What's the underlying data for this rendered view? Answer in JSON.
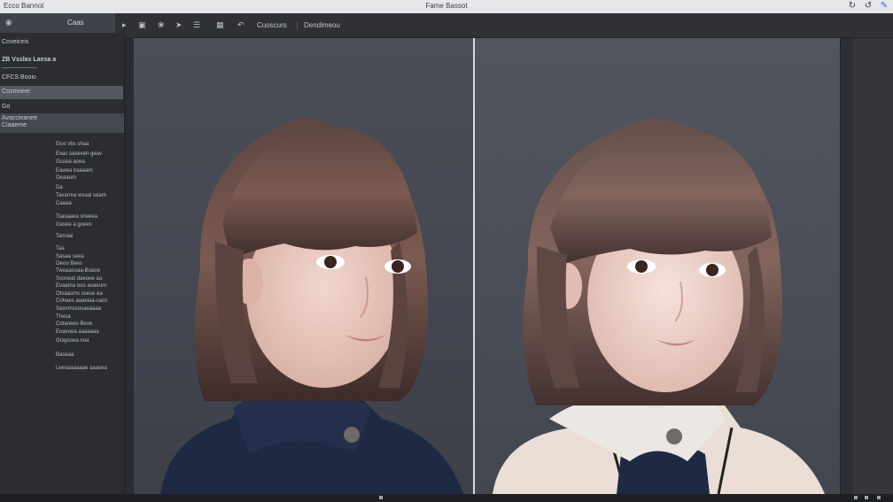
{
  "window": {
    "app_name": "Ecco Bannot",
    "title": "Fame Bassot"
  },
  "tab": {
    "label": "Caas"
  },
  "toolbar": {
    "breadcrumb_1": "Cuoscurs",
    "breadcrumb_2": "Dendimeou"
  },
  "left_panel": {
    "header": "Coveiceis",
    "title_row": "ZB Vsslas Laesa a",
    "item_1": "CFCS Booio",
    "item_selected": "Cosmoeer",
    "item_2": "Go",
    "section": "Avaccieanee",
    "section_sub": "Ciaaeme",
    "properties": [
      "Eios vbs shaa",
      "Exas saseven geav",
      "Gcoaa aoea",
      "Eawea baaaam",
      "Oeaaum",
      "Da",
      "Tavarrea wsaai seam",
      "Caaaa",
      "Tsasaaea sheeea",
      "Gasee a goees",
      "Tamaai",
      "Taa",
      "Sasaa seea",
      "Oeoo Bees",
      "Twoaasoaa-Boaoe",
      "Ssoneat daeoee aa",
      "Evaama ooo aoaeum",
      "Otsaasms ssese ea",
      "Cohaes aaaeiaa-caos",
      "Sasnmssosaeaaaa",
      "Thesa",
      "Cotanees Beoe",
      "Eoavoea aaaaaaa",
      "Grayssea noa",
      "Baseaa",
      "Leesaaaaaae aaasea"
    ]
  },
  "colors": {
    "titlebar_bg": "#e6e7e9",
    "panel_bg": "#2b2d32",
    "selection_bg": "#55585e",
    "canvas_bg": "#454851",
    "accent": "#3c64d8"
  },
  "icons": {
    "tab": "eye-icon",
    "tool_1": "crop-icon",
    "tool_2": "brush-icon",
    "tool_3": "send-icon",
    "tool_4": "mask-icon",
    "tool_5": "grid-icon",
    "tool_6": "undo-icon",
    "title_1": "refresh-icon",
    "title_2": "sync-icon",
    "title_3": "pen-icon"
  }
}
